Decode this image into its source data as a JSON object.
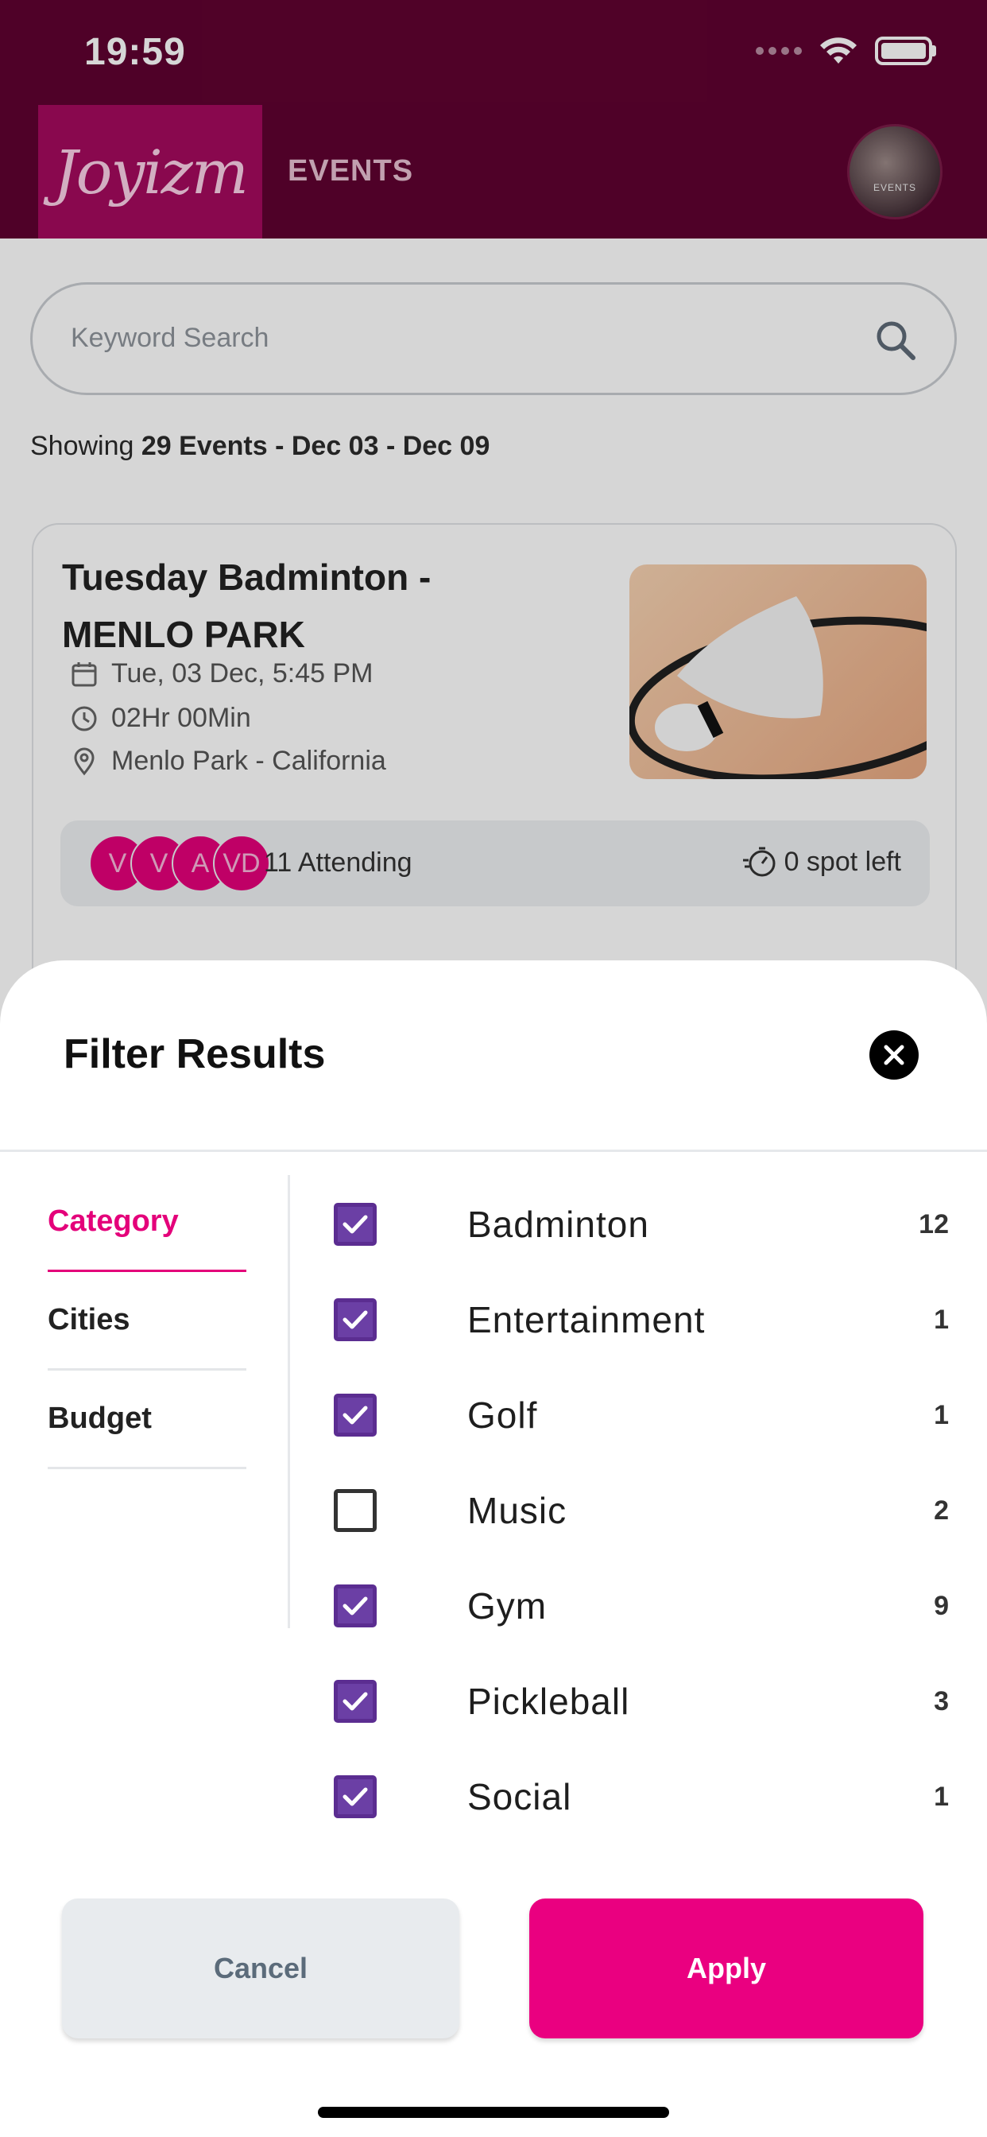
{
  "status_bar": {
    "time": "19:59"
  },
  "header": {
    "logo": "Joyizm",
    "title": "EVENTS",
    "avatar_label": "EVENTS"
  },
  "search": {
    "placeholder": "Keyword Search"
  },
  "summary": {
    "prefix": "Showing ",
    "count": "29 Events",
    "separator": " - ",
    "range": "Dec 03 - Dec 09"
  },
  "event": {
    "title": "Tuesday Badminton - MENLO PARK",
    "date": "Tue, 03 Dec, 5:45 PM",
    "duration": "02Hr 00Min",
    "location": "Menlo Park - California",
    "attendee_initials": [
      "V",
      "V",
      "A",
      "VD"
    ],
    "attending": "11 Attending",
    "spots_left": "0 spot left"
  },
  "filter": {
    "title": "Filter Results",
    "tabs": [
      {
        "label": "Category",
        "active": true
      },
      {
        "label": "Cities",
        "active": false
      },
      {
        "label": "Budget",
        "active": false
      }
    ],
    "options": [
      {
        "label": "Badminton",
        "count": "12",
        "checked": true
      },
      {
        "label": "Entertainment",
        "count": "1",
        "checked": true
      },
      {
        "label": "Golf",
        "count": "1",
        "checked": true
      },
      {
        "label": "Music",
        "count": "2",
        "checked": false
      },
      {
        "label": "Gym",
        "count": "9",
        "checked": true
      },
      {
        "label": "Pickleball",
        "count": "3",
        "checked": true
      },
      {
        "label": "Social",
        "count": "1",
        "checked": true
      }
    ],
    "cancel_label": "Cancel",
    "apply_label": "Apply"
  },
  "colors": {
    "brand_dark": "#5f0230",
    "brand_pink": "#ea0080",
    "checkbox_purple": "#6b3fa5"
  }
}
